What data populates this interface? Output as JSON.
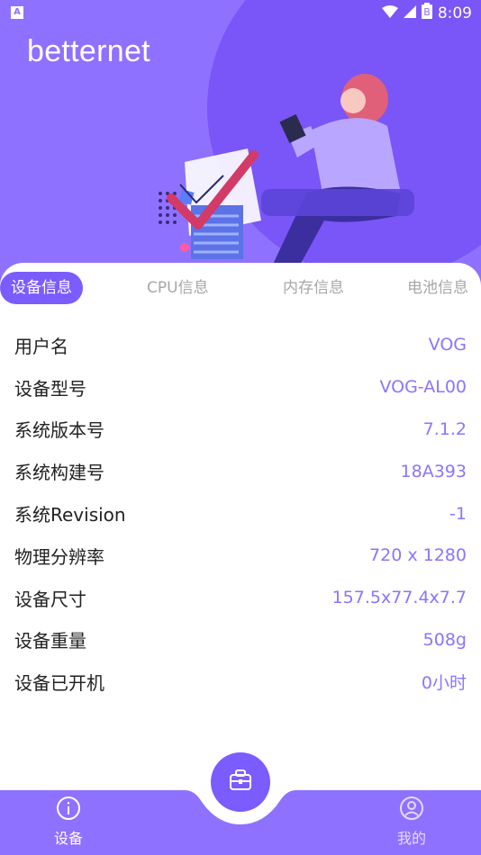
{
  "status_bar": {
    "left_badge": "A",
    "time": "8:09",
    "battery_badge": "B"
  },
  "app": {
    "title": "betternet"
  },
  "tabs": [
    {
      "label": "设备信息",
      "active": true
    },
    {
      "label": "CPU信息",
      "active": false
    },
    {
      "label": "内存信息",
      "active": false
    },
    {
      "label": "电池信息",
      "active": false
    }
  ],
  "rows": [
    {
      "label": "用户名",
      "value": "VOG"
    },
    {
      "label": "设备型号",
      "value": "VOG-AL00"
    },
    {
      "label": "系统版本号",
      "value": "7.1.2"
    },
    {
      "label": "系统构建号",
      "value": "18A393"
    },
    {
      "label": "系统Revision",
      "value": "-1"
    },
    {
      "label": "物理分辨率",
      "value": "720 x 1280"
    },
    {
      "label": "设备尺寸",
      "value": "157.5x77.4x7.7"
    },
    {
      "label": "设备重量",
      "value": "508g"
    },
    {
      "label": "设备已开机",
      "value": "0小时"
    }
  ],
  "bottom_nav": {
    "device_label": "设备",
    "mine_label": "我的"
  },
  "colors": {
    "accent": "#7b5cff",
    "hero_bg": "#8f71ff",
    "value_text": "#8c74ff"
  }
}
